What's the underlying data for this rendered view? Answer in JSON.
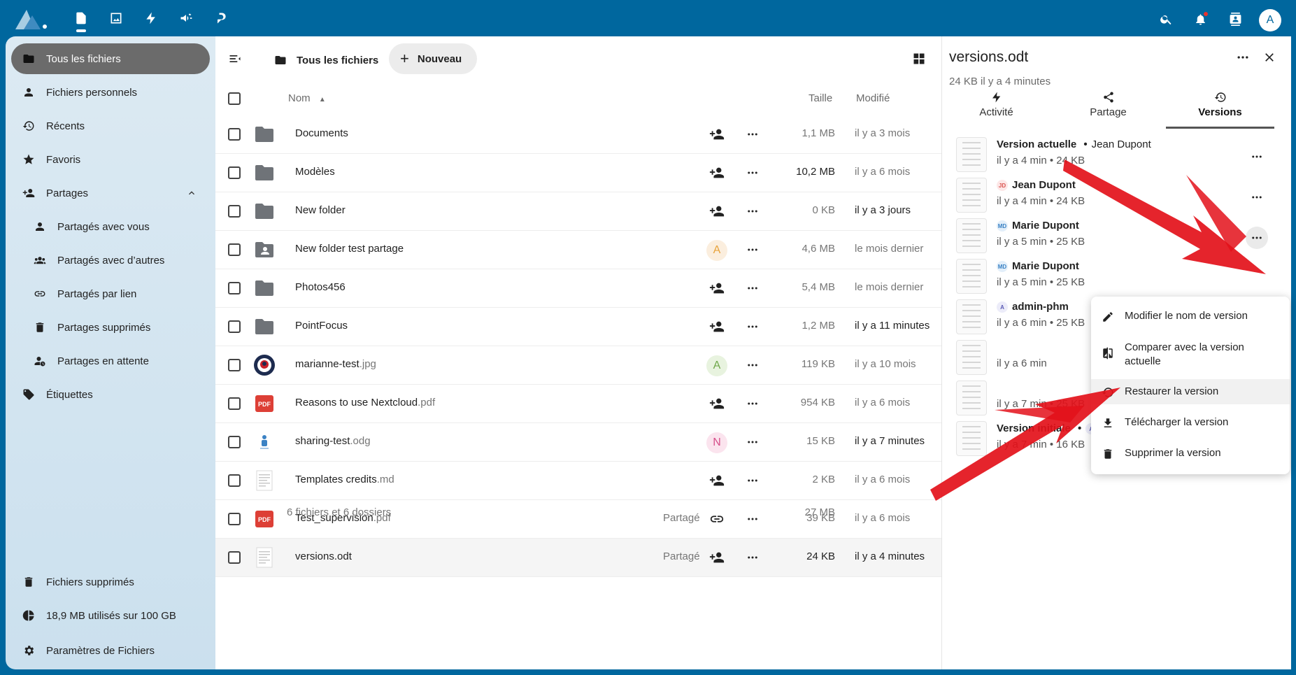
{
  "topbar": {
    "apps": [
      {
        "name": "files-app-icon"
      },
      {
        "name": "photos-app-icon"
      },
      {
        "name": "activity-app-icon"
      },
      {
        "name": "announcements-app-icon"
      },
      {
        "name": "talk-app-icon"
      }
    ],
    "avatar_letter": "A"
  },
  "sidebar": {
    "items": [
      {
        "label": "Tous les fichiers",
        "icon": "folder-icon"
      },
      {
        "label": "Fichiers personnels",
        "icon": "person-icon"
      },
      {
        "label": "Récents",
        "icon": "history-icon"
      },
      {
        "label": "Favoris",
        "icon": "star-icon"
      },
      {
        "label": "Partages",
        "icon": "share-person-icon"
      },
      {
        "label": "Partagés avec vous",
        "icon": "person-icon"
      },
      {
        "label": "Partagés avec d’autres",
        "icon": "group-icon"
      },
      {
        "label": "Partagés par lien",
        "icon": "link-icon"
      },
      {
        "label": "Partages supprimés",
        "icon": "trash-icon"
      },
      {
        "label": "Partages en attente",
        "icon": "pending-icon"
      },
      {
        "label": "Étiquettes",
        "icon": "tag-icon"
      }
    ],
    "trash_label": "Fichiers supprimés",
    "quota_label": "18,9 MB utilisés sur 100 GB",
    "settings_label": "Paramètres de Fichiers"
  },
  "files": {
    "breadcrumb": "Tous les fichiers",
    "new_label": "Nouveau",
    "columns": {
      "name": "Nom",
      "size": "Taille",
      "modified": "Modifié"
    },
    "rows": [
      {
        "name": "Documents",
        "ext": "",
        "size": "1,1 MB",
        "modified": "il y a 3 mois",
        "share": "add",
        "shared_label": ""
      },
      {
        "name": "Modèles",
        "ext": "",
        "size": "10,2 MB",
        "modified": "il y a 6 mois",
        "share": "add",
        "shared_label": ""
      },
      {
        "name": "New folder",
        "ext": "",
        "size": "0 KB",
        "modified": "il y a 3 jours",
        "share": "add",
        "shared_label": ""
      },
      {
        "name": "New folder test partage",
        "ext": "",
        "size": "4,6 MB",
        "modified": "le mois dernier",
        "share": "avatar",
        "avatar": "A",
        "shared_label": ""
      },
      {
        "name": "Photos456",
        "ext": "",
        "size": "5,4 MB",
        "modified": "le mois dernier",
        "share": "add",
        "shared_label": ""
      },
      {
        "name": "PointFocus",
        "ext": "",
        "size": "1,2 MB",
        "modified": "il y a 11 minutes",
        "share": "add",
        "shared_label": ""
      },
      {
        "name": "marianne-test",
        "ext": ".jpg",
        "size": "119 KB",
        "modified": "il y a 10 mois",
        "share": "avatar",
        "avatar": "A",
        "shared_label": ""
      },
      {
        "name": "Reasons to use Nextcloud",
        "ext": ".pdf",
        "size": "954 KB",
        "modified": "il y a 6 mois",
        "share": "add",
        "shared_label": ""
      },
      {
        "name": "sharing-test",
        "ext": ".odg",
        "size": "15 KB",
        "modified": "il y a 7 minutes",
        "share": "avatar",
        "avatar": "N",
        "shared_label": ""
      },
      {
        "name": "Templates credits",
        "ext": ".md",
        "size": "2 KB",
        "modified": "il y a 6 mois",
        "share": "add",
        "shared_label": ""
      },
      {
        "name": "Test_supervision",
        "ext": ".pdf",
        "size": "39 KB",
        "modified": "il y a 6 mois",
        "share": "link",
        "shared_label": "Partagé"
      },
      {
        "name": "versions.odt",
        "ext": "",
        "size": "24 KB",
        "modified": "il y a 4 minutes",
        "share": "add",
        "shared_label": "Partagé"
      }
    ],
    "pdf_badge": "PDF",
    "summary": "6 fichiers et 6 dossiers",
    "summary_size": "27 MB"
  },
  "details": {
    "title": "versions.odt",
    "subtitle": "24 KB il y a 4 minutes",
    "tabs": [
      {
        "label": "Activité"
      },
      {
        "label": "Partage"
      },
      {
        "label": "Versions"
      }
    ],
    "versions": [
      {
        "label": "Version actuelle",
        "author": "Jean Dupont",
        "initials": "",
        "meta": "il y a 4 min • 24 KB"
      },
      {
        "label": "",
        "author": "Jean Dupont",
        "initials": "JD",
        "meta": "il y a 4 min • 24 KB"
      },
      {
        "label": "",
        "author": "Marie Dupont",
        "initials": "MD",
        "meta": "il y a 5 min • 25 KB"
      },
      {
        "label": "",
        "author": "Marie Dupont",
        "initials": "MD",
        "meta": "il y a 5 min • 25 KB"
      },
      {
        "label": "",
        "author": "admin-phm",
        "initials": "A",
        "meta": "il y a 6 min • 25 KB"
      },
      {
        "label": "",
        "author": "",
        "initials": "",
        "meta": "il y a 6 min"
      },
      {
        "label": "",
        "author": "",
        "initials": "",
        "meta": "il y a 7 min • 25 KB"
      },
      {
        "label": "Version initiale",
        "author": "admin-phm",
        "initials": "A",
        "meta": "il y a 7 min • 16 KB"
      }
    ]
  },
  "version_menu": {
    "items": [
      {
        "label": "Modifier le nom de version"
      },
      {
        "label": "Comparer avec la version actuelle"
      },
      {
        "label": "Restaurer la version"
      },
      {
        "label": "Télécharger la version"
      },
      {
        "label": "Supprimer la version"
      }
    ]
  },
  "colors": {
    "header": "#00679e",
    "annotation_arrow": "#e3111a",
    "avatar_orange": "#e8a33b",
    "avatar_green": "#6fa84a",
    "avatar_pink": "#d64f8a"
  }
}
